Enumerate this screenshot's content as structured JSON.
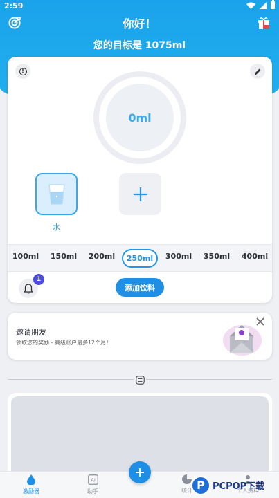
{
  "status_bar": {
    "time": "2:59"
  },
  "header": {
    "greeting": "你好！",
    "goal": "您的目标是 1075ml",
    "left_icon": "target-icon",
    "right_icon": "gift-icon"
  },
  "tracker": {
    "current_amount": "0ml",
    "progress_percent": 0,
    "drinks": [
      {
        "label": "水",
        "icon": "water-glass-icon",
        "selected": true
      }
    ],
    "add_tile_icon": "plus-icon",
    "volumes": [
      "100ml",
      "150ml",
      "200ml",
      "250ml",
      "300ml",
      "350ml",
      "400ml"
    ],
    "selected_volume": "250ml",
    "reminder_badge": "1",
    "add_drink_label": "添加饮料"
  },
  "invite": {
    "title": "邀请朋友",
    "description": "领取您的奖励 - 高级账户最多12个月！"
  },
  "nav": {
    "items": [
      {
        "label": "激励器",
        "icon": "drop-icon",
        "active": true
      },
      {
        "label": "助手",
        "icon": "ai-icon",
        "active": false
      },
      {
        "label": "统计",
        "icon": "pie-chart-icon",
        "active": false
      },
      {
        "label": "个人资料",
        "icon": "profile-icon",
        "active": false
      }
    ]
  },
  "watermark": {
    "text": "PCPOP下载"
  },
  "colors": {
    "primary": "#1f8fe6",
    "header": "#1aa3ea",
    "badge": "#4b49e0"
  }
}
